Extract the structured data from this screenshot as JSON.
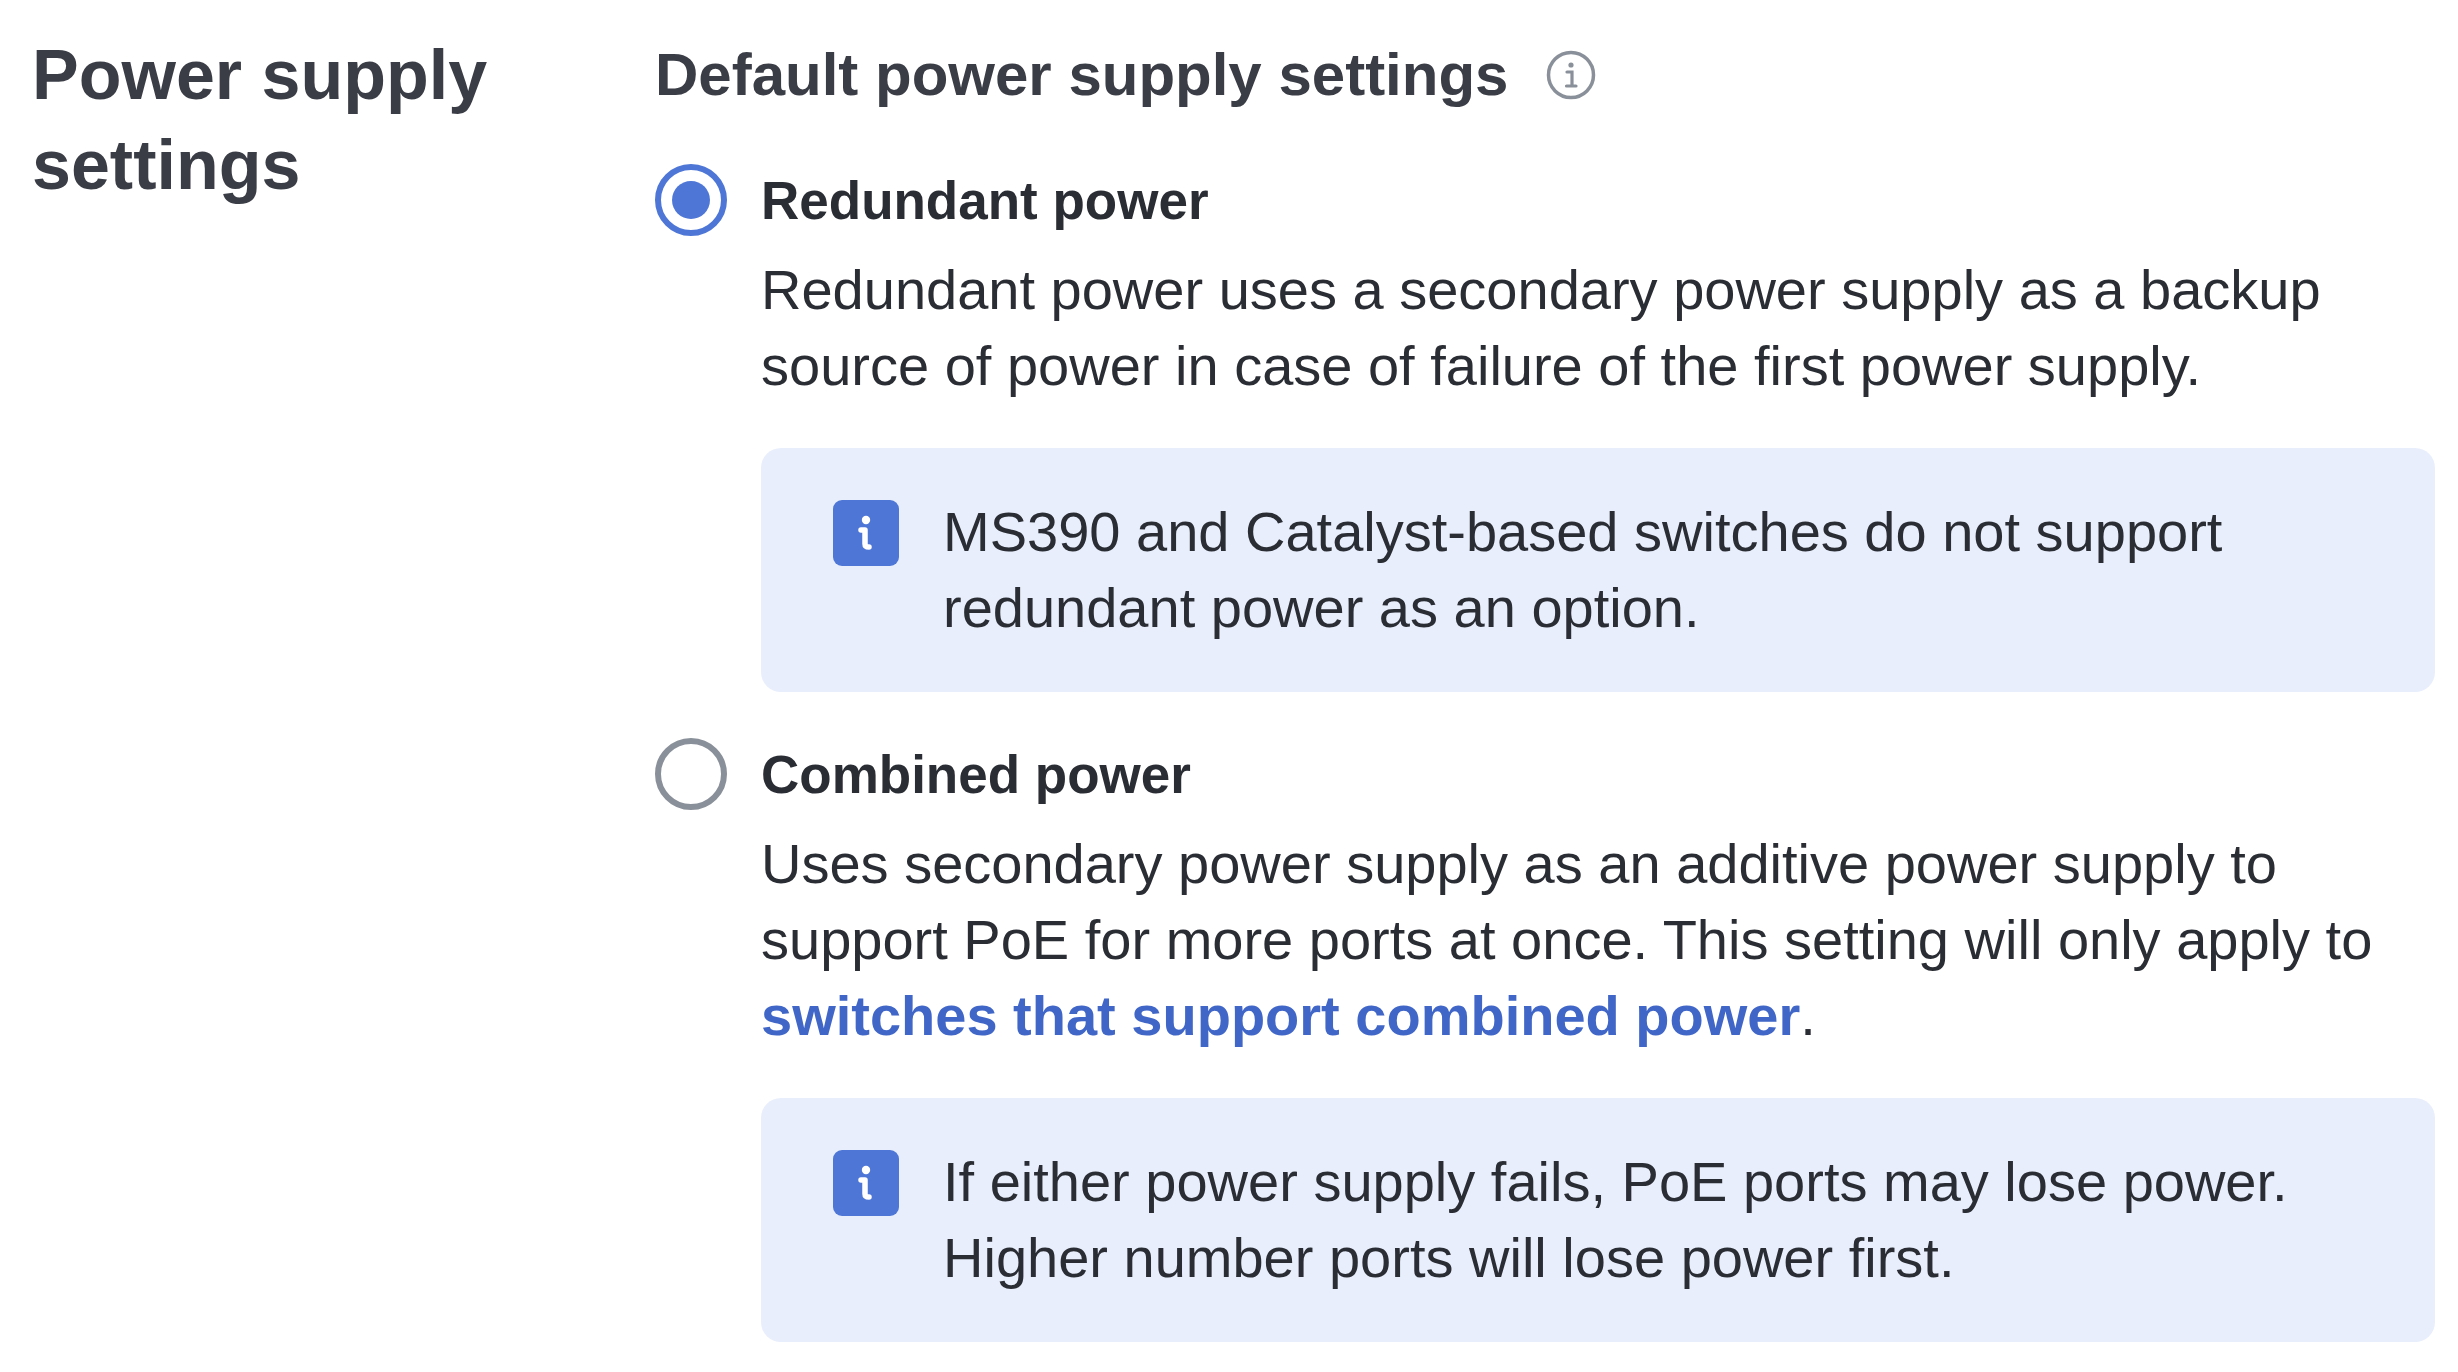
{
  "page_title": "Power supply settings",
  "section": {
    "title": "Default power supply settings",
    "options": [
      {
        "label": "Redundant power",
        "selected": true,
        "description": [
          {
            "kind": "text",
            "text": "Redundant power uses a secondary power supply as a backup source of power in case of failure of the first power supply."
          }
        ],
        "note": "MS390 and Catalyst-based switches do not support redundant power as an option."
      },
      {
        "label": "Combined power",
        "selected": false,
        "description": [
          {
            "kind": "text",
            "text": "Uses secondary power supply as an additive power supply to support PoE for more ports at once. This setting will only apply to "
          },
          {
            "kind": "link",
            "text": "switches that support combined power"
          },
          {
            "kind": "text",
            "text": "."
          }
        ],
        "note": "If either power supply fails, PoE ports may lose power. Higher number ports will lose power first."
      }
    ]
  }
}
